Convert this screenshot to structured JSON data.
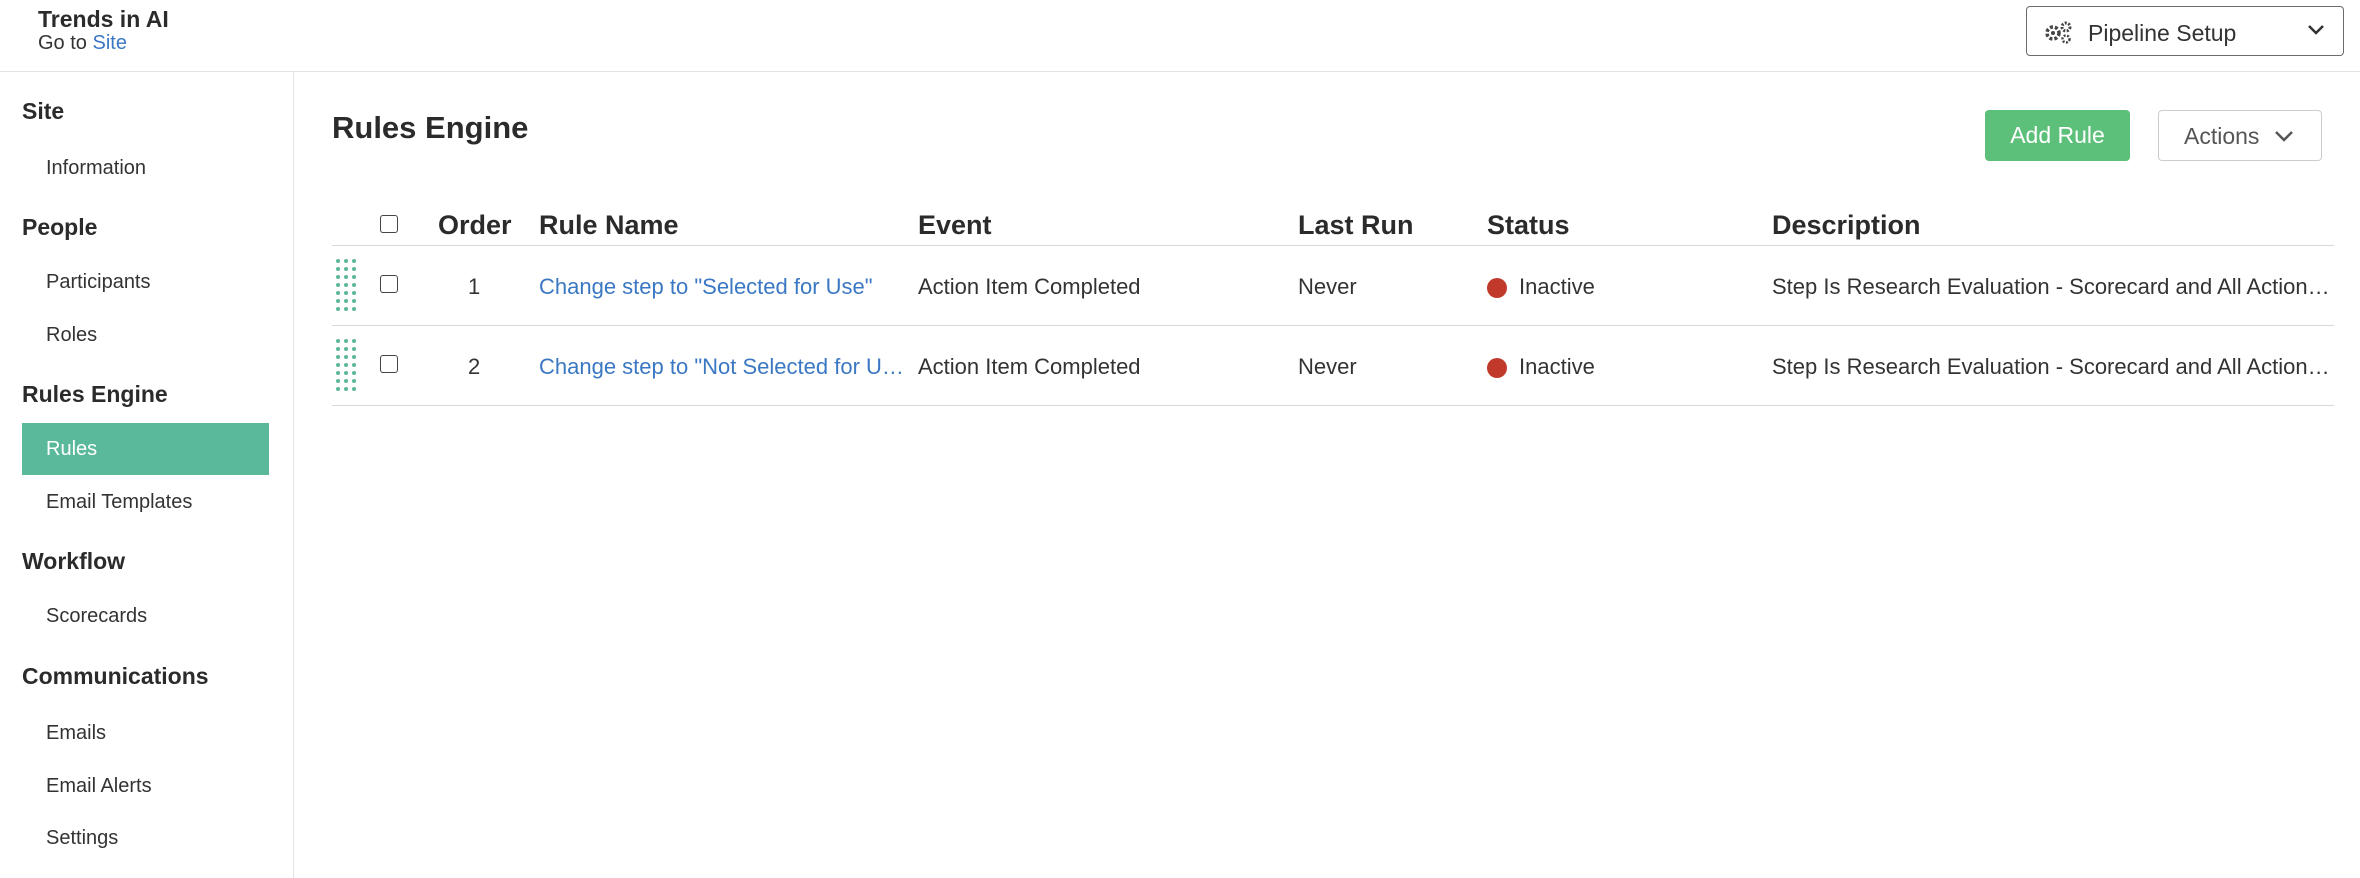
{
  "header": {
    "site_title": "Trends in AI",
    "goto_prefix": "Go to",
    "goto_link": "Site",
    "pipeline_label": "Pipeline Setup"
  },
  "sidebar": {
    "sections": [
      {
        "heading": "Site",
        "items": [
          "Information"
        ]
      },
      {
        "heading": "People",
        "items": [
          "Participants",
          "Roles"
        ]
      },
      {
        "heading": "Rules Engine",
        "items": [
          "Rules",
          "Email Templates"
        ]
      },
      {
        "heading": "Workflow",
        "items": [
          "Scorecards"
        ]
      },
      {
        "heading": "Communications",
        "items": [
          "Emails",
          "Email Alerts",
          "Settings"
        ]
      }
    ],
    "active_item": "Rules"
  },
  "main": {
    "title": "Rules Engine",
    "add_rule_label": "Add Rule",
    "actions_label": "Actions"
  },
  "table": {
    "columns": {
      "order": "Order",
      "rule_name": "Rule Name",
      "event": "Event",
      "last_run": "Last Run",
      "status": "Status",
      "description": "Description"
    },
    "rows": [
      {
        "order": "1",
        "rule_name": "Change step to \"Selected for Use\"",
        "event": "Action Item Completed",
        "last_run": "Never",
        "status": "Inactive",
        "description": "Step Is Research Evaluation - Scorecard and All Action It..."
      },
      {
        "order": "2",
        "rule_name": "Change step to \"Not Selected for Us...",
        "event": "Action Item Completed",
        "last_run": "Never",
        "status": "Inactive",
        "description": "Step Is Research Evaluation - Scorecard and All Action It..."
      }
    ]
  },
  "colors": {
    "accent": "#5bb99b",
    "add_button": "#5cc07a",
    "link": "#3b78c3",
    "status_inactive": "#c0392b"
  },
  "icons": {
    "pipeline": "gears-icon",
    "dropdown": "chevron-down-icon",
    "drag": "drag-handle-icon",
    "status": "status-dot-icon"
  }
}
